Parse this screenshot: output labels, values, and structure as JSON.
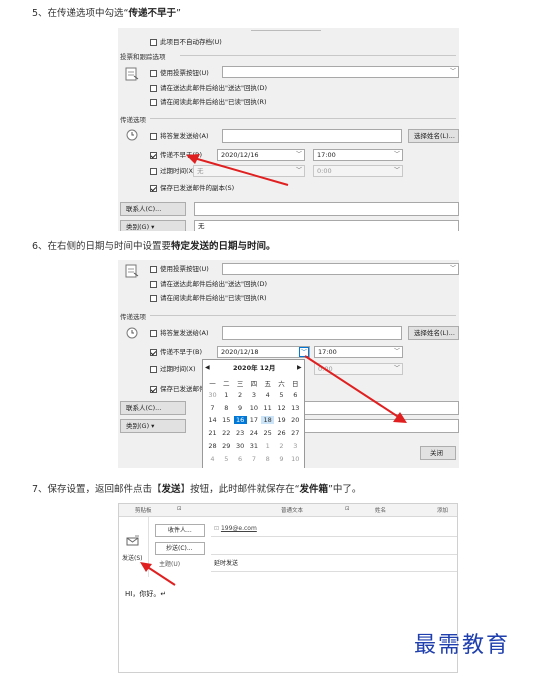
{
  "steps": {
    "s5_prefix": "5、在传递选项中勾选“",
    "s5_bold": "传递不早于",
    "s5_suffix": "”",
    "s6_prefix": "6、在右侧的日期与时间中设置要",
    "s6_bold": "特定发送的日期与时间。",
    "s7_a": "7、保存设置，返回邮件点击【",
    "s7_b": "发送",
    "s7_c": "】按钮，此时邮件就保存在“",
    "s7_d": "发件箱",
    "s7_e": "”中了。"
  },
  "dialog1": {
    "no_autoarchive": "此项目不自动存档(U)",
    "voting_section": "投票和跟踪选项",
    "use_voting": "使用投票按钮(U)",
    "delivery_receipt": "请在送达此邮件后给出\"送达\"回执(D)",
    "read_receipt": "请在阅读此邮件后给出\"已读\"回执(R)",
    "delivery_section": "传递选项",
    "reply_to": "将答复发送给(A)",
    "select_names": "选择姓名(L)...",
    "no_earlier": "传递不早于(B)",
    "date": "2020/12/16",
    "time": "17:00",
    "expires": "过期时间(X)",
    "expires_date": "无",
    "expires_time": "0:00",
    "save_copy": "保存已发送邮件的副本(S)",
    "contacts": "联系人(C)...",
    "categories": "类别(G)",
    "categories_value": "无"
  },
  "dialog2": {
    "use_voting": "使用投票按钮(U)",
    "delivery_receipt": "请在送达此邮件后给出\"送达\"回执(D)",
    "read_receipt": "请在阅读此邮件后给出\"已读\"回执(R)",
    "delivery_section": "传递选项",
    "reply_to": "将答复发送给(A)",
    "select_names": "选择姓名(L)...",
    "no_earlier": "传递不早于(B)",
    "date": "2020/12/18",
    "time": "17:00",
    "expires": "过期时间(X)",
    "expires_time": "0:00",
    "save_copy": "保存已发送邮件",
    "contacts": "联系人(C)...",
    "categories": "类别(G)",
    "close": "关闭"
  },
  "calendar": {
    "month": "2020年 12月",
    "weekdays": [
      "一",
      "二",
      "三",
      "四",
      "五",
      "六",
      "日"
    ],
    "weeks": [
      [
        "30",
        "1",
        "2",
        "3",
        "4",
        "5",
        "6"
      ],
      [
        "7",
        "8",
        "9",
        "10",
        "11",
        "12",
        "13"
      ],
      [
        "14",
        "15",
        "16",
        "17",
        "18",
        "19",
        "20"
      ],
      [
        "21",
        "22",
        "23",
        "24",
        "25",
        "26",
        "27"
      ],
      [
        "28",
        "29",
        "30",
        "31",
        "1",
        "2",
        "3"
      ],
      [
        "4",
        "5",
        "6",
        "7",
        "8",
        "9",
        "10"
      ]
    ],
    "selected": "16",
    "highlighted": "18"
  },
  "mail": {
    "clipboard": "剪贴板",
    "basic_text": "普通文本",
    "names": "姓名",
    "add": "添加",
    "to": "收件人...",
    "to_value": "199@e.com",
    "cc": "抄送(C)...",
    "subject": "主题(U)",
    "subject_value": "延时发送",
    "send": "发送(S)",
    "body": "HI，你好。↵"
  },
  "watermark": "最需教育",
  "colors": {
    "accent": "#0078d7",
    "arrow": "#e02020",
    "watermark": "#1f3fae"
  }
}
